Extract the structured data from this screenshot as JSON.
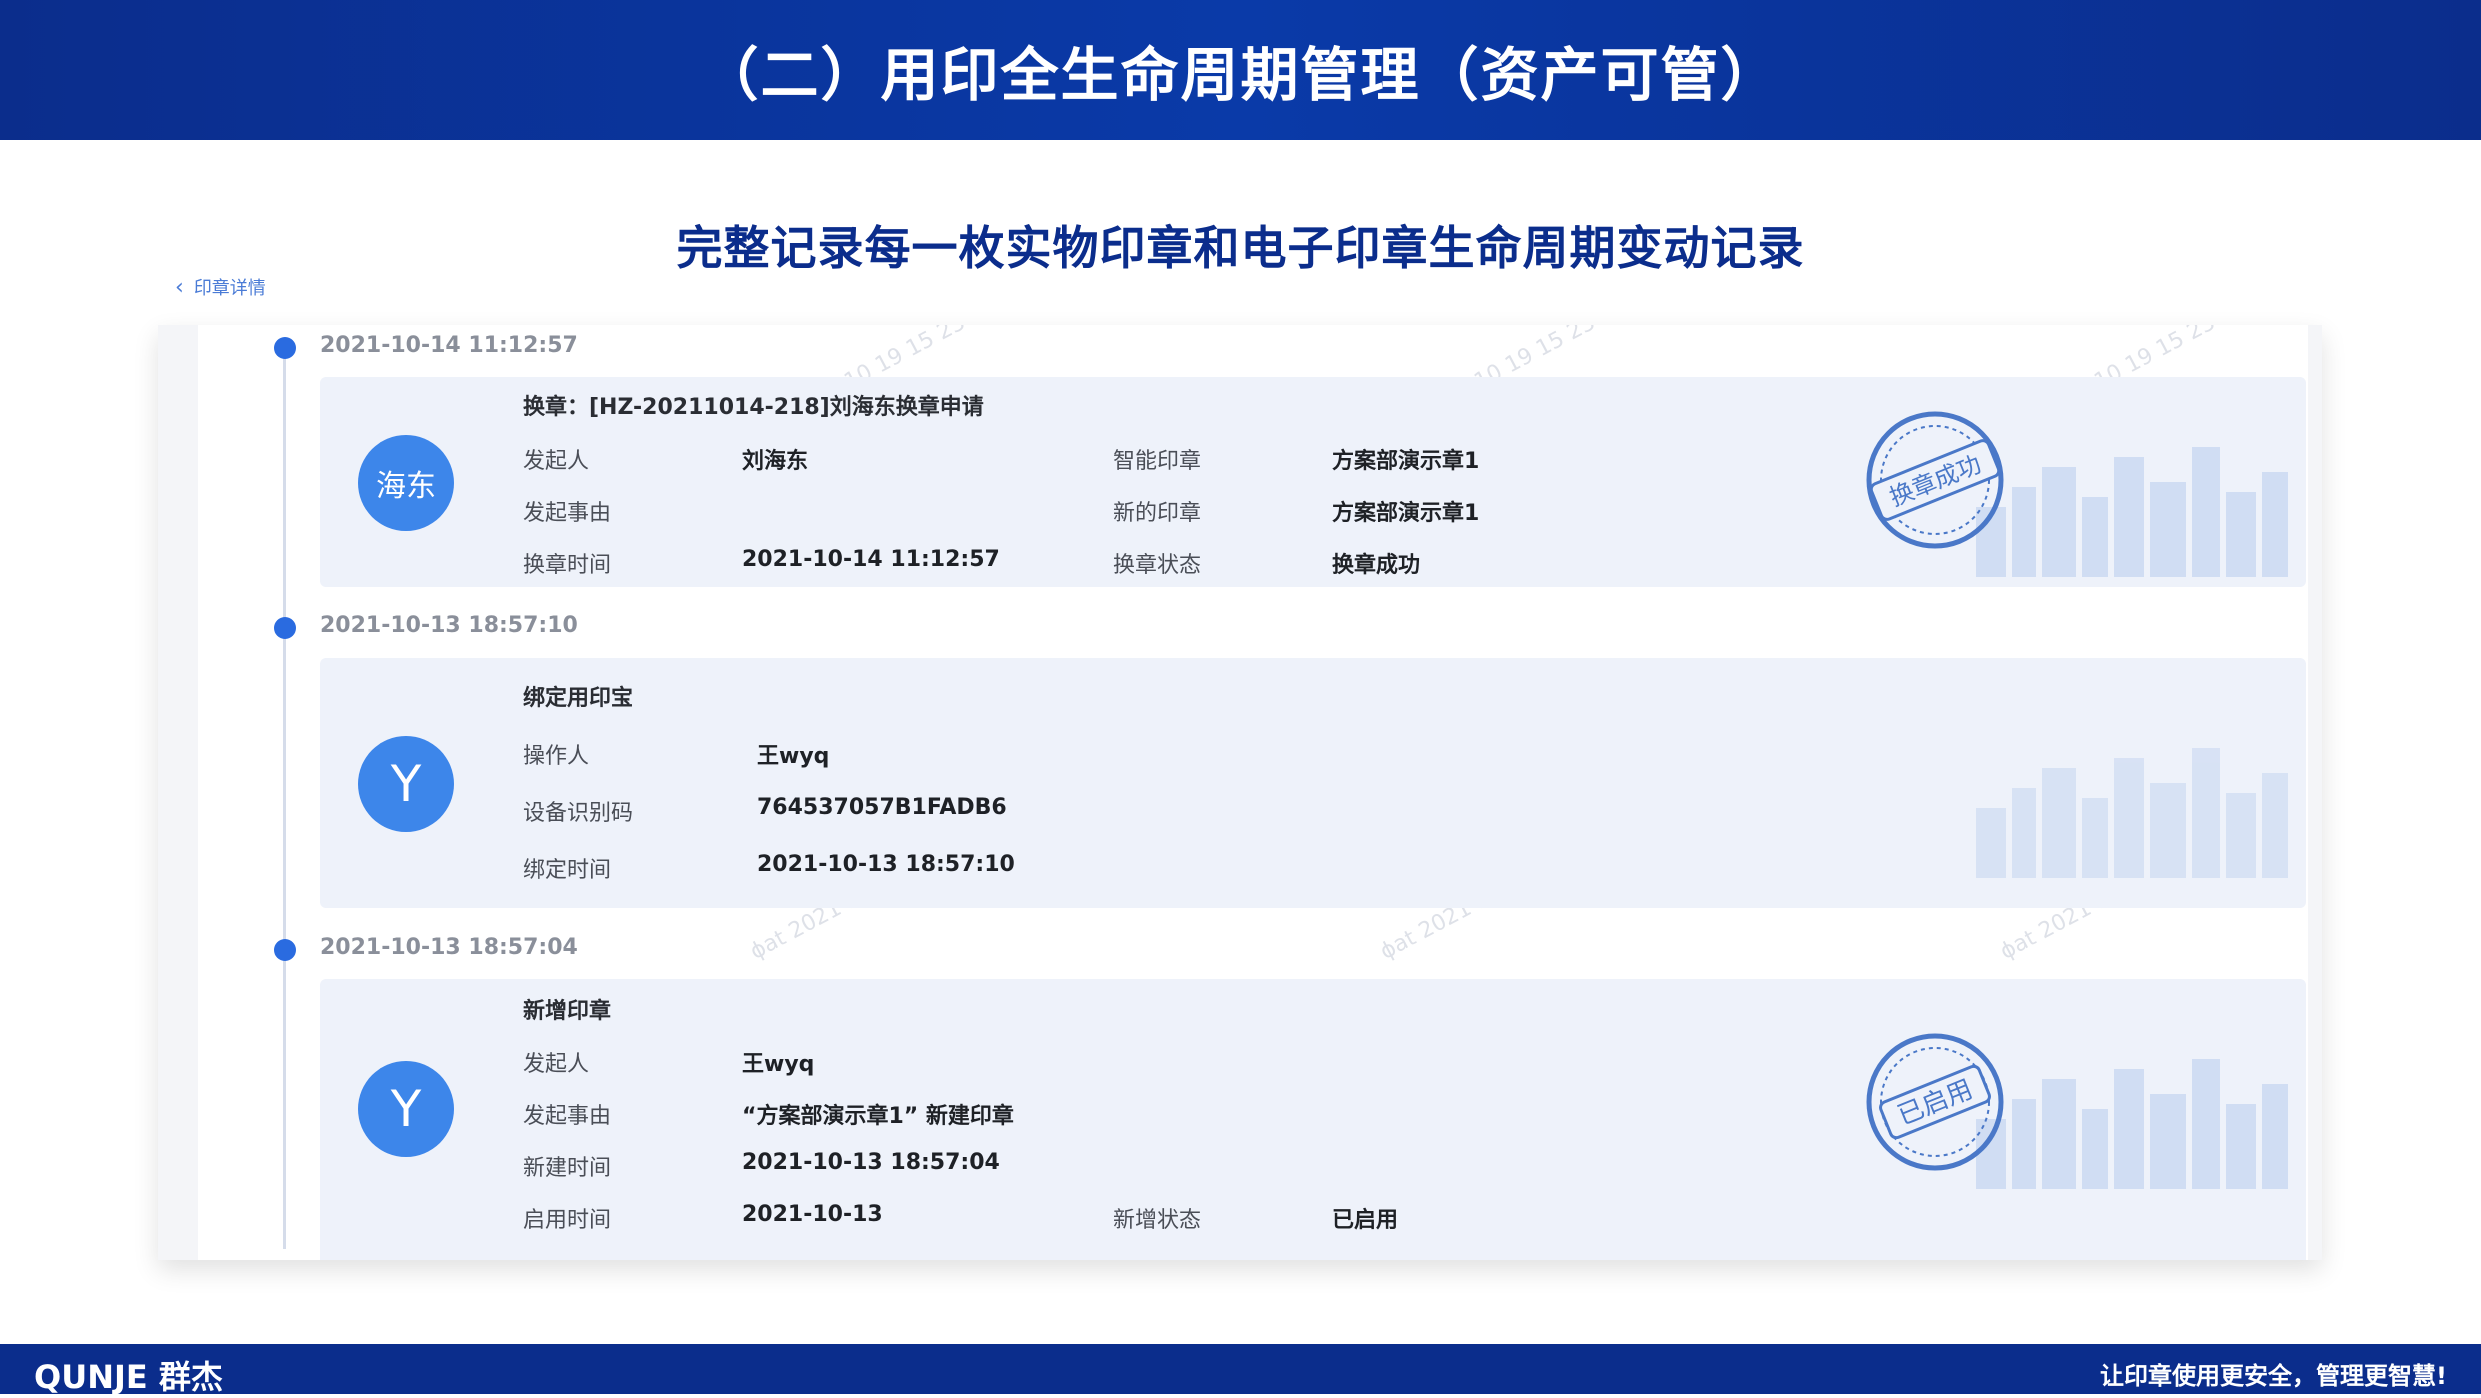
{
  "slide": {
    "title": "（二）用印全生命周期管理（资产可管）",
    "subtitle": "完整记录每一枚实物印章和电子印章生命周期变动记录",
    "footer_brand": "QUNJE 群杰",
    "footer_slogan": "让印章使用更安全，管理更智慧!"
  },
  "app": {
    "back_label": "印章详情",
    "events": [
      {
        "timestamp": "2021-10-14 11:12:57",
        "avatar": "海东",
        "title": "换章：[HZ-20211014-218]刘海东换章申请",
        "left_fields": [
          {
            "label": "发起人",
            "value": "刘海东"
          },
          {
            "label": "发起事由",
            "value": ""
          },
          {
            "label": "换章时间",
            "value": "2021-10-14 11:12:57"
          }
        ],
        "right_fields": [
          {
            "label": "智能印章",
            "value": "方案部演示章1"
          },
          {
            "label": "新的印章",
            "value": "方案部演示章1"
          },
          {
            "label": "换章状态",
            "value": "换章成功"
          }
        ],
        "stamp_text": "换章成功"
      },
      {
        "timestamp": "2021-10-13 18:57:10",
        "avatar": "Y",
        "title": "绑定用印宝",
        "left_fields": [
          {
            "label": "操作人",
            "value": "王wyq"
          },
          {
            "label": "设备识别码",
            "value": "764537057B1FADB6"
          },
          {
            "label": "绑定时间",
            "value": "2021-10-13 18:57:10"
          }
        ]
      },
      {
        "timestamp": "2021-10-13 18:57:04",
        "avatar": "Y",
        "title": "新增印章",
        "left_fields": [
          {
            "label": "发起人",
            "value": "王wyq"
          },
          {
            "label": "发起事由",
            "value": "“方案部演示章1” 新建印章"
          },
          {
            "label": "新建时间",
            "value": "2021-10-13 18:57:04"
          },
          {
            "label": "启用时间",
            "value": "2021-10-13"
          }
        ],
        "right_fields": [
          {
            "label": "新增状态",
            "value": "已启用"
          }
        ],
        "stamp_text": "已启用"
      }
    ]
  },
  "colors": {
    "banner": "#0b2d8c",
    "accent": "#2a6be0",
    "avatar": "#3d86ea",
    "card_bg": "#eef2fa"
  }
}
